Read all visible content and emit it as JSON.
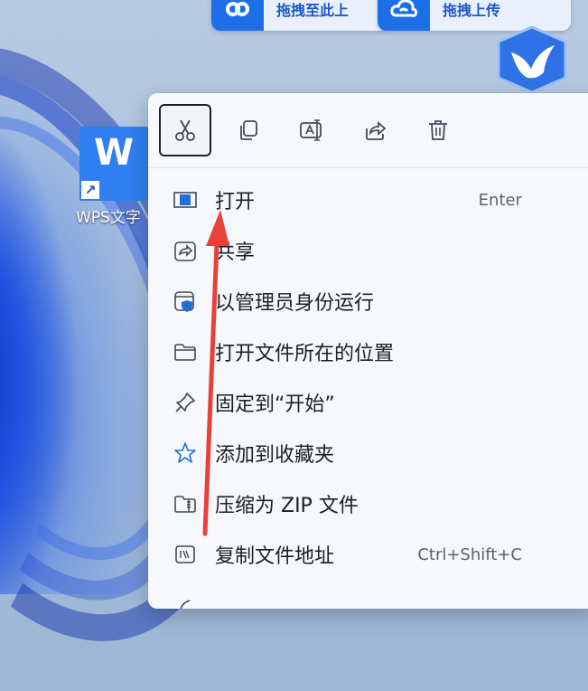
{
  "top_buttons": [
    {
      "label": "拖拽至此上",
      "icon": "link-icon"
    },
    {
      "label": "拖拽上传",
      "icon": "cloud-icon"
    }
  ],
  "desktop_icon": {
    "tile_letter": "W",
    "shortcut_glyph": "↗",
    "name": "WPS文字"
  },
  "toolbar": {
    "tools": [
      {
        "name": "cut-icon",
        "active": true
      },
      {
        "name": "copy-icon",
        "active": false
      },
      {
        "name": "rename-icon",
        "active": false
      },
      {
        "name": "share-icon",
        "active": false
      },
      {
        "name": "delete-icon",
        "active": false
      }
    ]
  },
  "menu": {
    "items": [
      {
        "label": "打开",
        "shortcut": "Enter",
        "icon": "open-icon"
      },
      {
        "label": "共享",
        "shortcut": "",
        "icon": "share-icon"
      },
      {
        "label": "以管理员身份运行",
        "shortcut": "",
        "icon": "admin-shield-icon"
      },
      {
        "label": "打开文件所在的位置",
        "shortcut": "",
        "icon": "folder-icon"
      },
      {
        "label": "固定到“开始”",
        "shortcut": "",
        "icon": "pin-icon"
      },
      {
        "label": "添加到收藏夹",
        "shortcut": "",
        "icon": "star-icon"
      },
      {
        "label": "压缩为 ZIP 文件",
        "shortcut": "",
        "icon": "zip-icon"
      },
      {
        "label": "复制文件地址",
        "shortcut": "Ctrl+Shift+C",
        "icon": "copy-path-icon"
      }
    ]
  },
  "annotation": {
    "arrow_color": "#e8413a"
  }
}
